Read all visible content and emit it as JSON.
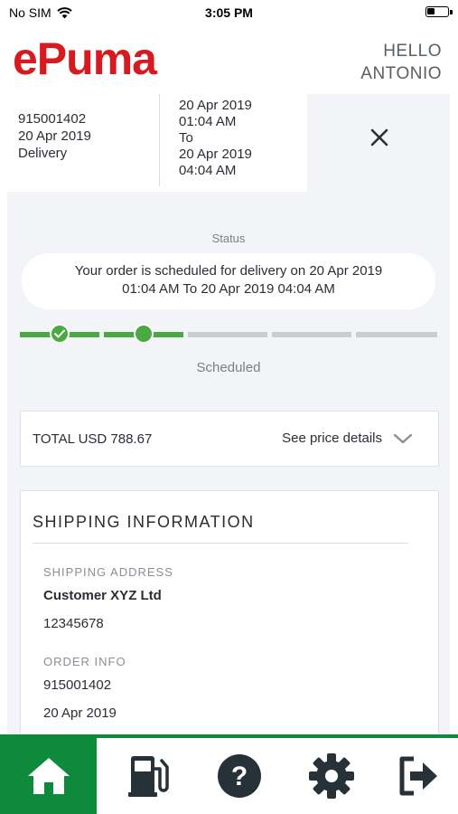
{
  "status_bar": {
    "carrier": "No SIM",
    "time": "3:05 PM"
  },
  "header": {
    "logo": "ePuma",
    "greeting_line1": "HELLO",
    "greeting_line2": "ANTONIO"
  },
  "order_summary": {
    "order_number": "915001402",
    "order_date": "20 Apr 2019",
    "order_type": "Delivery",
    "window_start_date": "20 Apr 2019",
    "window_start_time": "01:04 AM",
    "window_to": "To",
    "window_end_date": "20 Apr 2019",
    "window_end_time": "04:04 AM"
  },
  "status": {
    "label": "Status",
    "message_line1": "Your order is scheduled for delivery on 20 Apr 2019",
    "message_line2": "01:04 AM To 20 Apr 2019 04:04 AM",
    "current_stage": "Scheduled",
    "progress": {
      "completed_steps": 2,
      "total_steps": 5
    }
  },
  "total": {
    "label": "TOTAL USD 788.67",
    "details_link": "See price details"
  },
  "shipping": {
    "title": "SHIPPING INFORMATION",
    "address_label": "SHIPPING ADDRESS",
    "customer_name": "Customer XYZ Ltd",
    "customer_id": "12345678",
    "order_info_label": "ORDER INFO",
    "order_number": "915001402",
    "order_date": "20 Apr 2019"
  },
  "tabbar": {
    "items": [
      {
        "icon": "home-icon",
        "active": true
      },
      {
        "icon": "fuel-pump-icon",
        "active": false
      },
      {
        "icon": "help-icon",
        "active": false
      },
      {
        "icon": "settings-icon",
        "active": false
      },
      {
        "icon": "logout-icon",
        "active": false
      }
    ]
  },
  "colors": {
    "brand_red": "#d71920",
    "brand_green": "#0e8a3c",
    "progress_green": "#49a942",
    "progress_gray": "#c9ccd1",
    "icon_dark": "#263138"
  }
}
